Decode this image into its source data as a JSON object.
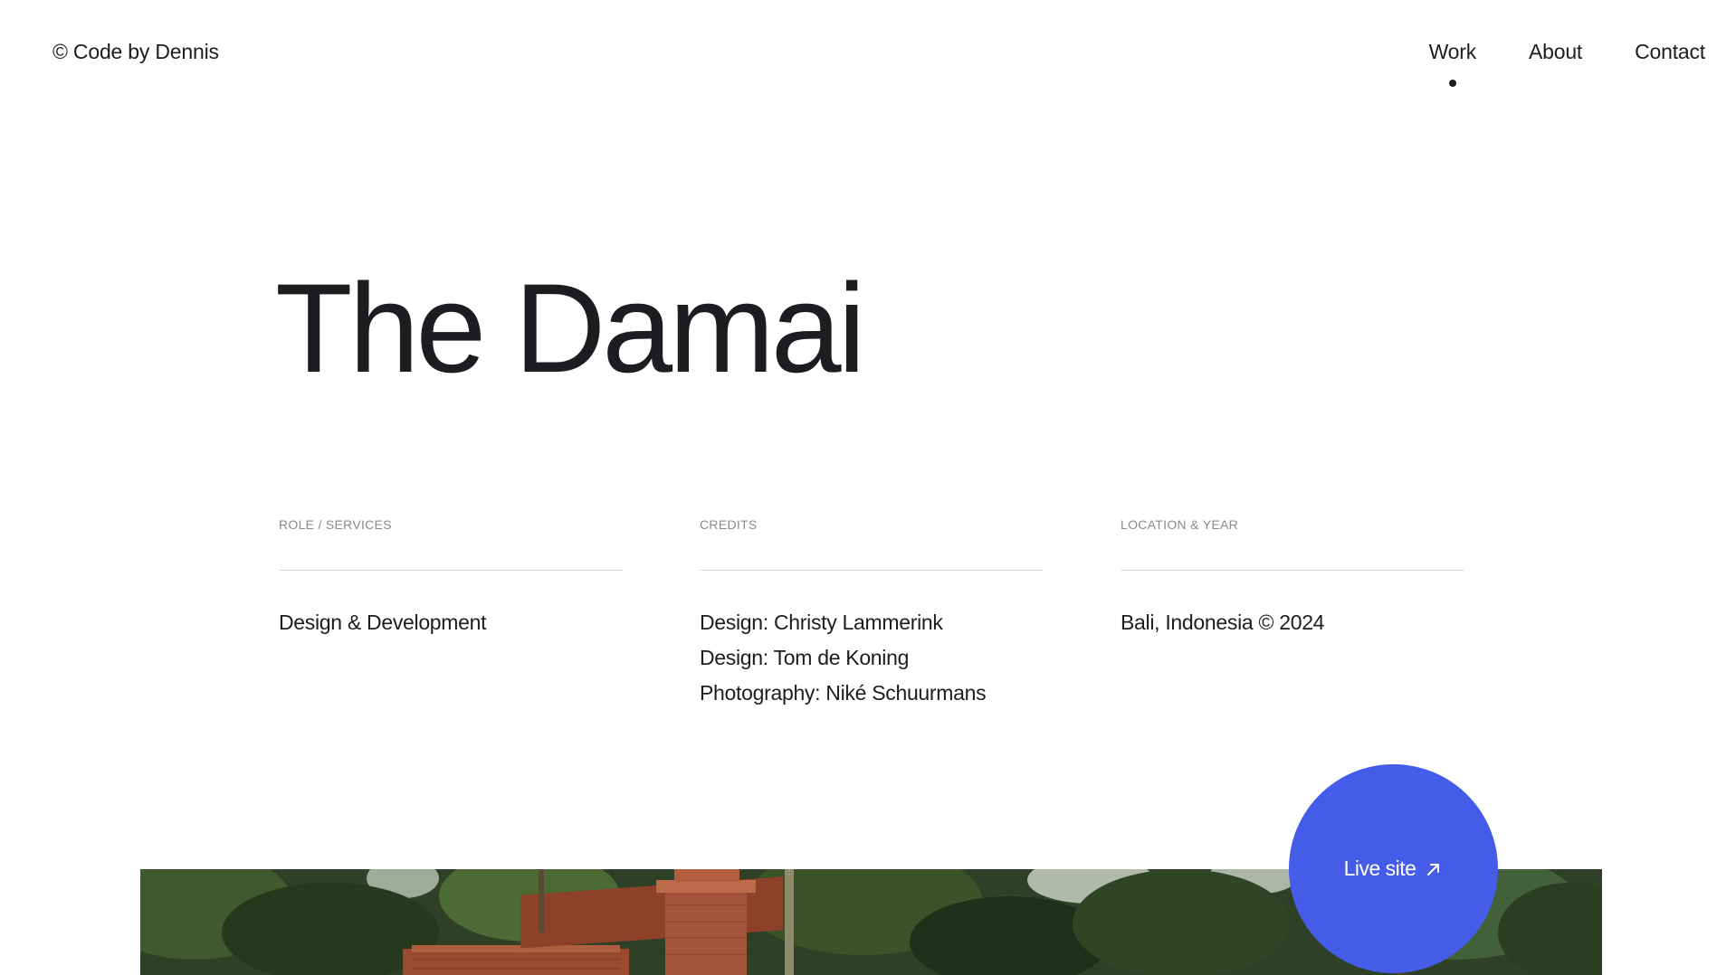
{
  "header": {
    "brand": "© Code by Dennis",
    "nav": [
      {
        "label": "Work",
        "active": true
      },
      {
        "label": "About",
        "active": false
      },
      {
        "label": "Contact",
        "active": false
      }
    ]
  },
  "project": {
    "title": "The Damai",
    "columns": [
      {
        "heading": "ROLE / SERVICES",
        "values": [
          "Design & Development"
        ]
      },
      {
        "heading": "CREDITS",
        "values": [
          "Design: Christy Lammerink",
          "Design: Tom de Koning",
          "Photography: Niké Schuurmans"
        ]
      },
      {
        "heading": "LOCATION & YEAR",
        "values": [
          "Bali, Indonesia © 2024"
        ]
      }
    ]
  },
  "live_site": {
    "label": "Live site",
    "icon": "arrow-up-right-icon",
    "color": "#455ce9"
  },
  "colors": {
    "text": "#1c1d20",
    "muted": "#8a8a8e",
    "accent": "#455ce9"
  }
}
